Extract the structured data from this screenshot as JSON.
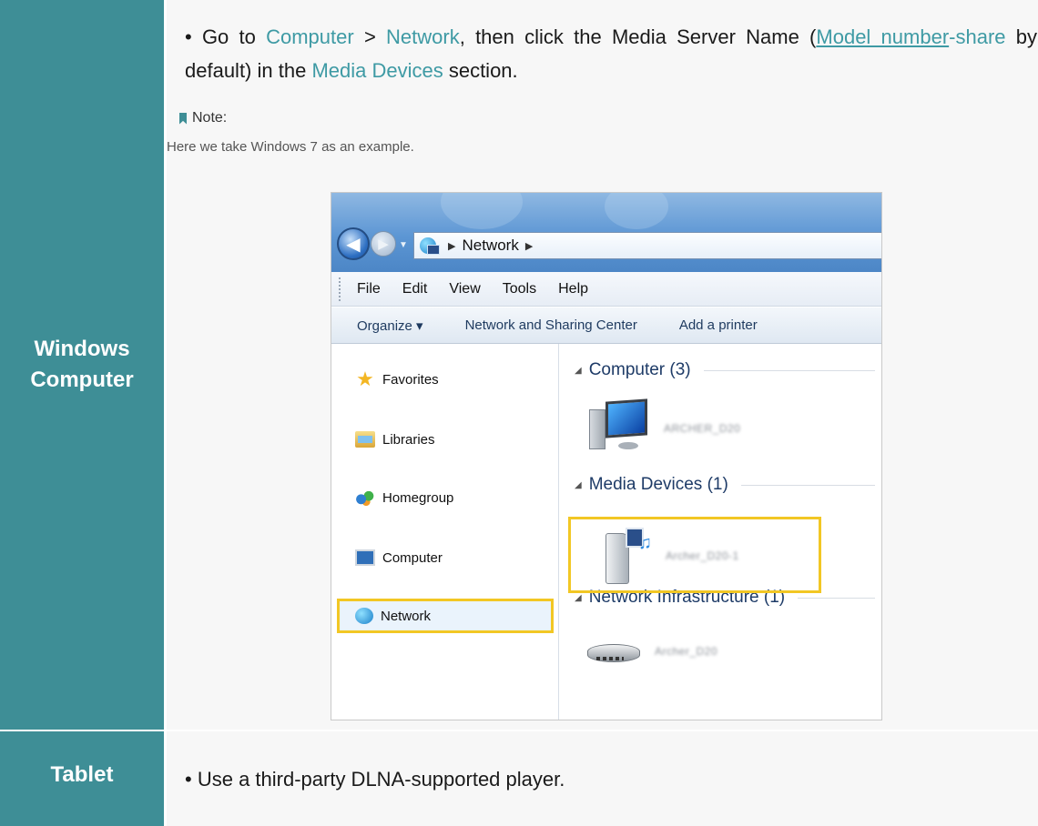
{
  "rows": {
    "windows": {
      "label": "Windows\nComputer",
      "instruction": {
        "prefix": "Go to ",
        "link1": "Computer",
        "sep": " > ",
        "link2": "Network",
        "mid": ", then click the Media Server Name (",
        "link3": "Model number",
        "link3_suffix": "-share",
        "mid2": " by default) in the ",
        "link4": "Media Devices",
        "suffix": " section."
      },
      "note_label": "Note:",
      "note_text": "Here we take Windows 7 as an example."
    },
    "tablet": {
      "label": "Tablet",
      "instruction": "Use a third-party DLNA-supported player."
    }
  },
  "screenshot": {
    "address": "Network",
    "menu": [
      "File",
      "Edit",
      "View",
      "Tools",
      "Help"
    ],
    "commands": [
      "Organize ▾",
      "Network and Sharing Center",
      "Add a printer"
    ],
    "nav_items": [
      {
        "label": "Favorites",
        "icon": "star-icon"
      },
      {
        "label": "Libraries",
        "icon": "libraries-icon"
      },
      {
        "label": "Homegroup",
        "icon": "homegroup-icon"
      },
      {
        "label": "Computer",
        "icon": "computer-icon"
      },
      {
        "label": "Network",
        "icon": "network-icon",
        "highlighted": true
      }
    ],
    "groups": [
      {
        "title": "Computer (3)",
        "item_label": "ARCHER_D20"
      },
      {
        "title": "Media Devices (1)",
        "item_label": "Archer_D20-1"
      },
      {
        "title": "Network Infrastructure (1)",
        "item_label": "Archer_D20"
      }
    ]
  },
  "colors": {
    "accent": "#3e8e96",
    "link": "#3e9aa4",
    "highlight": "#f2c724"
  }
}
